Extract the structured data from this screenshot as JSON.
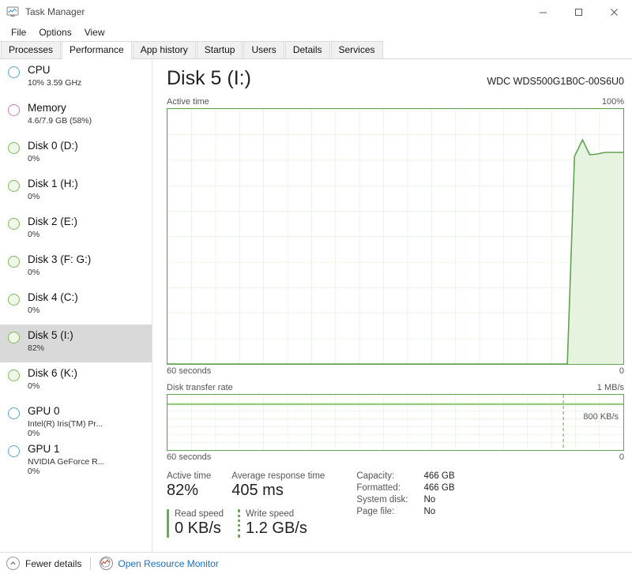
{
  "window": {
    "title": "Task Manager",
    "icon": "task-manager-icon",
    "controls": {
      "minimize": "—",
      "maximize": "☐",
      "close": "✕"
    }
  },
  "menu": {
    "items": [
      "File",
      "Options",
      "View"
    ]
  },
  "tabs": {
    "items": [
      {
        "label": "Processes",
        "active": false
      },
      {
        "label": "Performance",
        "active": true
      },
      {
        "label": "App history",
        "active": false
      },
      {
        "label": "Startup",
        "active": false
      },
      {
        "label": "Users",
        "active": false
      },
      {
        "label": "Details",
        "active": false
      },
      {
        "label": "Services",
        "active": false
      }
    ]
  },
  "sidebar": {
    "items": [
      {
        "name": "CPU",
        "sub": "10% 3.59 GHz",
        "sub2": "",
        "color": "blue",
        "selected": false
      },
      {
        "name": "Memory",
        "sub": "4.6/7.9 GB (58%)",
        "sub2": "",
        "color": "purple",
        "selected": false
      },
      {
        "name": "Disk 0 (D:)",
        "sub": "0%",
        "sub2": "",
        "color": "green",
        "selected": false
      },
      {
        "name": "Disk 1 (H:)",
        "sub": "0%",
        "sub2": "",
        "color": "green",
        "selected": false
      },
      {
        "name": "Disk 2 (E:)",
        "sub": "0%",
        "sub2": "",
        "color": "green",
        "selected": false
      },
      {
        "name": "Disk 3 (F: G:)",
        "sub": "0%",
        "sub2": "",
        "color": "green",
        "selected": false
      },
      {
        "name": "Disk 4 (C:)",
        "sub": "0%",
        "sub2": "",
        "color": "green",
        "selected": false
      },
      {
        "name": "Disk 5 (I:)",
        "sub": "82%",
        "sub2": "",
        "color": "green",
        "selected": true
      },
      {
        "name": "Disk 6 (K:)",
        "sub": "0%",
        "sub2": "",
        "color": "green",
        "selected": false
      },
      {
        "name": "GPU 0",
        "sub": "Intel(R) Iris(TM) Pr...",
        "sub2": "0%",
        "color": "blue",
        "selected": false
      },
      {
        "name": "GPU 1",
        "sub": "NVIDIA GeForce R...",
        "sub2": "0%",
        "color": "blue",
        "selected": false
      }
    ]
  },
  "main": {
    "device_title": "Disk 5 (I:)",
    "device_model": "WDC WDS500G1B0C-00S6U0",
    "active_graph": {
      "label": "Active time",
      "max_label": "100%",
      "time_label": "60 seconds",
      "zero_label": "0"
    },
    "rate_graph": {
      "label": "Disk transfer rate",
      "max_label": "1 MB/s",
      "marker_label": "800 KB/s",
      "time_label": "60 seconds",
      "zero_label": "0"
    },
    "stats": {
      "active_time_label": "Active time",
      "active_time_value": "82%",
      "response_label": "Average response time",
      "response_value": "405 ms",
      "read_label": "Read speed",
      "read_value": "0 KB/s",
      "write_label": "Write speed",
      "write_value": "1.2 GB/s",
      "details": [
        {
          "key": "Capacity:",
          "value": "466 GB"
        },
        {
          "key": "Formatted:",
          "value": "466 GB"
        },
        {
          "key": "System disk:",
          "value": "No"
        },
        {
          "key": "Page file:",
          "value": "No"
        }
      ]
    }
  },
  "statusbar": {
    "fewer_details": "Fewer details",
    "fewer_icon": "chevron-up-icon",
    "resource_monitor": "Open Resource Monitor",
    "resource_icon": "resource-monitor-icon"
  },
  "colors": {
    "graph_line": "#64a353",
    "graph_fill": "#e3f1dc",
    "grid": "#d6ead0",
    "accent_link": "#1a6fc4",
    "selected_row": "#d9d9d9"
  },
  "chart_data": [
    {
      "type": "area",
      "title": "Active time",
      "ylabel": "Active time",
      "xlabel": "60 seconds",
      "ylim": [
        0,
        100
      ],
      "xlim": [
        0,
        60
      ],
      "grid": true,
      "x": [
        0,
        6,
        12,
        18,
        24,
        30,
        36,
        42,
        48,
        51,
        53,
        55,
        57,
        58,
        59,
        60
      ],
      "values": [
        0,
        0,
        0,
        0,
        0,
        0,
        0,
        0,
        0,
        0,
        78,
        86,
        80,
        81,
        82,
        82
      ],
      "unit": "%"
    },
    {
      "type": "line",
      "title": "Disk transfer rate",
      "ylabel": "Disk transfer rate",
      "xlabel": "60 seconds",
      "ylim": [
        0,
        1
      ],
      "xlim": [
        0,
        60
      ],
      "grid": true,
      "annotations": [
        "800 KB/s"
      ],
      "x": [
        0,
        10,
        20,
        30,
        40,
        50,
        60
      ],
      "values": [
        0.82,
        0.82,
        0.82,
        0.82,
        0.82,
        0.82,
        0.82
      ],
      "unit": "MB/s"
    }
  ]
}
